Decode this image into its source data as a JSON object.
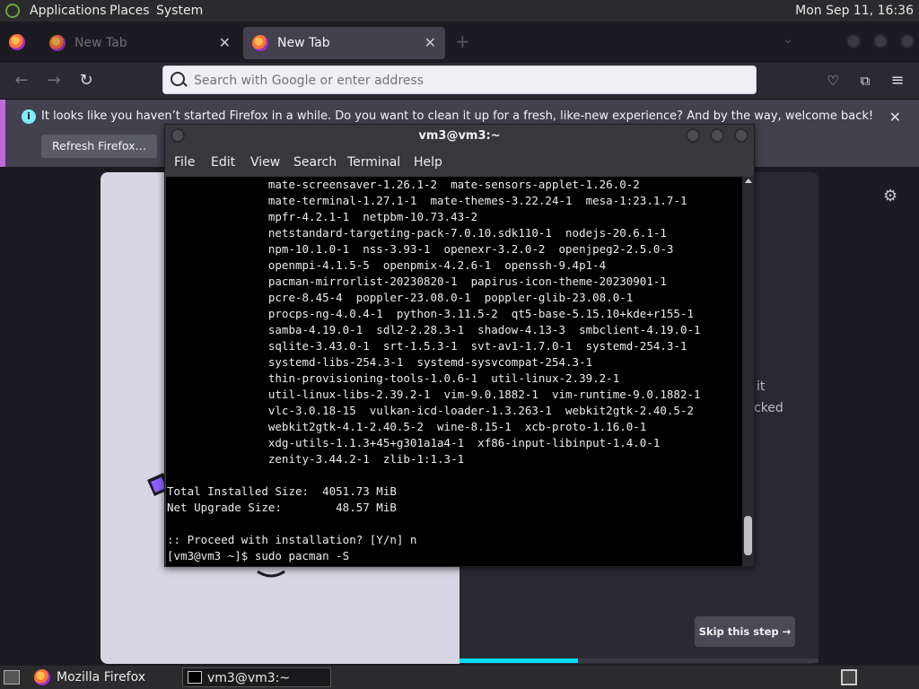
{
  "top_panel": {
    "menus": [
      "Applications",
      "Places",
      "System"
    ],
    "clock": "Mon Sep 11, 16:36"
  },
  "firefox": {
    "tabs": [
      {
        "label": "New Tab",
        "active": false
      },
      {
        "label": "New Tab",
        "active": true
      }
    ],
    "new_tab_symbol": "+",
    "urlbar_placeholder": "Search with Google or enter address",
    "notification": {
      "message": "It looks like you haven’t started Firefox in a while. Do you want to clean it up for a fresh, like-new experience? And by the way, welcome back!",
      "button": "Refresh Firefox…"
    },
    "onboarding": {
      "partial_text_1": "it",
      "partial_text_2": "cked",
      "skip_button": "Skip this step",
      "progress_fraction": 0.33
    }
  },
  "terminal": {
    "title": "vm3@vm3:~",
    "menu": [
      "File",
      "Edit",
      "View",
      "Search",
      "Terminal",
      "Help"
    ],
    "lines": [
      "               mate-screensaver-1.26.1-2  mate-sensors-applet-1.26.0-2",
      "               mate-terminal-1.27.1-1  mate-themes-3.22.24-1  mesa-1:23.1.7-1",
      "               mpfr-4.2.1-1  netpbm-10.73.43-2",
      "               netstandard-targeting-pack-7.0.10.sdk110-1  nodejs-20.6.1-1",
      "               npm-10.1.0-1  nss-3.93-1  openexr-3.2.0-2  openjpeg2-2.5.0-3",
      "               openmpi-4.1.5-5  openpmix-4.2.6-1  openssh-9.4p1-4",
      "               pacman-mirrorlist-20230820-1  papirus-icon-theme-20230901-1",
      "               pcre-8.45-4  poppler-23.08.0-1  poppler-glib-23.08.0-1",
      "               procps-ng-4.0.4-1  python-3.11.5-2  qt5-base-5.15.10+kde+r155-1",
      "               samba-4.19.0-1  sdl2-2.28.3-1  shadow-4.13-3  smbclient-4.19.0-1",
      "               sqlite-3.43.0-1  srt-1.5.3-1  svt-av1-1.7.0-1  systemd-254.3-1",
      "               systemd-libs-254.3-1  systemd-sysvcompat-254.3-1",
      "               thin-provisioning-tools-1.0.6-1  util-linux-2.39.2-1",
      "               util-linux-libs-2.39.2-1  vim-9.0.1882-1  vim-runtime-9.0.1882-1",
      "               vlc-3.0.18-15  vulkan-icd-loader-1.3.263-1  webkit2gtk-2.40.5-2",
      "               webkit2gtk-4.1-2.40.5-2  wine-8.15-1  xcb-proto-1.16.0-1",
      "               xdg-utils-1.1.3+45+g301a1a4-1  xf86-input-libinput-1.4.0-1",
      "               zenity-3.44.2-1  zlib-1:1.3-1",
      "",
      "Total Installed Size:  4051.73 MiB",
      "Net Upgrade Size:        48.57 MiB",
      "",
      ":: Proceed with installation? [Y/n] n",
      "[vm3@vm3 ~]$ sudo pacman -S"
    ]
  },
  "bottom_panel": {
    "tasks": [
      {
        "label": "Mozilla Firefox",
        "active": false
      },
      {
        "label": "vm3@vm3:~",
        "active": true
      }
    ]
  },
  "icons": {
    "back": "arrow-left-icon",
    "forward": "arrow-right-icon",
    "reload": "reload-icon",
    "pocket": "pocket-icon",
    "extensions": "puzzle-icon",
    "menu": "hamburger-icon",
    "info": "info-icon",
    "gear": "gear-icon"
  },
  "colors": {
    "panel": "#2b2b2e",
    "firefox_bg": "#1c1b22",
    "notif_bg": "#42414d",
    "accent_progress": "#00ddff",
    "terminal_bg": "#000000"
  }
}
